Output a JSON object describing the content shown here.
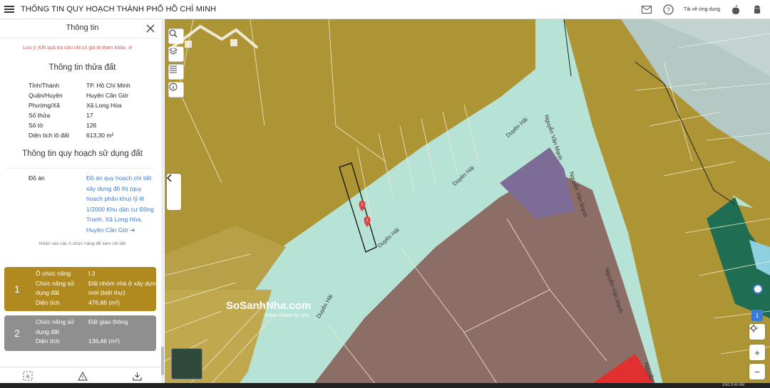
{
  "app": {
    "title": "THÔNG TIN QUY HOẠCH THÀNH PHỐ HỒ CHÍ MINH",
    "download_label": "Tải về ứng dụng",
    "icons": [
      "mail-icon",
      "help-icon",
      "apple-icon",
      "android-icon"
    ]
  },
  "panel": {
    "title": "Thông tin",
    "note": "Lưu ý: Kết quả tra cứu chỉ có giá trị tham khảo.",
    "parcel": {
      "heading": "Thông tin thửa đất",
      "rows": [
        {
          "k": "Tỉnh/Thành",
          "v": "TP. Hồ Chí Minh"
        },
        {
          "k": "Quận/Huyện",
          "v": "Huyện Cần Giờ"
        },
        {
          "k": "Phường/Xã",
          "v": "Xã Long Hòa"
        },
        {
          "k": "Số thửa",
          "v": "17"
        },
        {
          "k": "Số tờ",
          "v": "126"
        },
        {
          "k": "Diện tích lô đất",
          "v": "613,30 m²"
        }
      ]
    },
    "planning": {
      "heading": "Thông tin quy hoạch sử dụng đất",
      "plan_label": "Đồ án",
      "plan_value": "Đồ án quy hoạch chi tiết xây dựng đô thị (quy hoạch phân khu) tỷ lệ 1/2000 Khu dân cư Đồng Tranh, Xã Long Hòa, Huyện Cần Giờ ➔",
      "hint": "Nhấn vào các ô chức năng để xem chi tiết"
    },
    "zones": [
      {
        "num": "1",
        "color": "#b08a1e",
        "rows": [
          {
            "k": "Ô chức năng",
            "v": "I.3"
          },
          {
            "k": "Chức năng sử dụng đất",
            "v": "Đất nhóm nhà ở xây dựng mới (biệt thự)"
          },
          {
            "k": "Diện tích",
            "v": "476,86 (m²)"
          }
        ]
      },
      {
        "num": "2",
        "color": "#8f8f8f",
        "rows": [
          {
            "k": "Chức năng sử dụng đất",
            "v": "Đất giao thông"
          },
          {
            "k": "Diện tích",
            "v": "136,46 (m²)"
          }
        ]
      }
    ]
  },
  "map": {
    "streets": [
      {
        "name": "Duyên Hải"
      },
      {
        "name": "Duyên Hải"
      },
      {
        "name": "Duyên Hải"
      },
      {
        "name": "Duyên Hải"
      },
      {
        "name": "Nguyễn Văn Mạnh"
      },
      {
        "name": "Nguyễn Văn Mạnh"
      },
      {
        "name": "Nguyễn Văn Mạnh"
      },
      {
        "name": "Nguyễn"
      }
    ],
    "markers": [
      "1",
      "2"
    ],
    "layer_badge": "1",
    "watermark": {
      "brand": "SoSanhNha.com",
      "slogan": "Great choice for you"
    },
    "colors": {
      "residential": "#ad9434",
      "road": "#b6e3d6",
      "commercial": "#8d6e66",
      "purple": "#7d6d96",
      "red": "#e03030",
      "green": "#1f6e54"
    }
  },
  "taskbar": {
    "lang": "ENG",
    "time": "8:46 AM"
  }
}
